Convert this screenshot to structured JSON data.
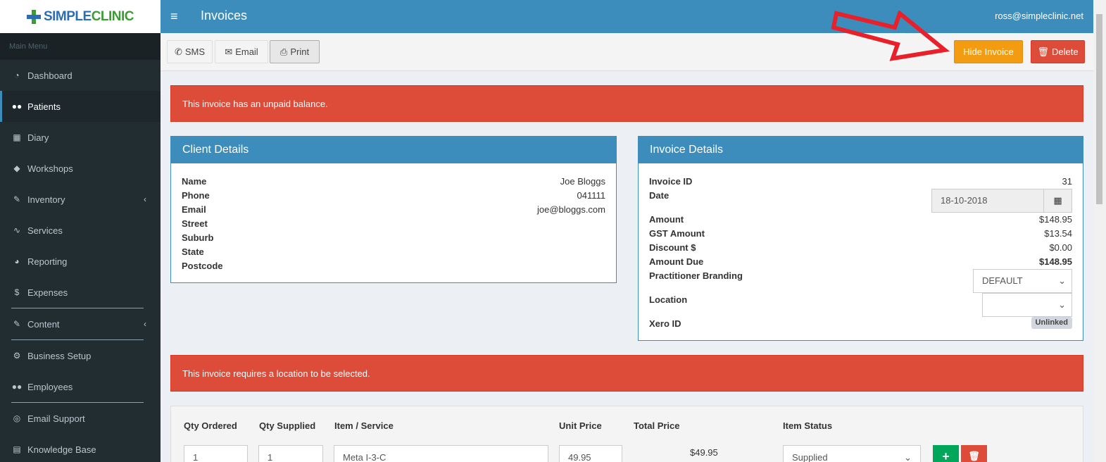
{
  "logo": {
    "part1": "SIMPLE",
    "part2": "CLINIC"
  },
  "sidebar": {
    "header": "Main Menu",
    "items": [
      {
        "label": "Dashboard",
        "icon": "dashboard-icon"
      },
      {
        "label": "Patients",
        "icon": "users-icon",
        "active": true
      },
      {
        "label": "Diary",
        "icon": "calendar-icon"
      },
      {
        "label": "Workshops",
        "icon": "graduation-cap-icon"
      },
      {
        "label": "Inventory",
        "icon": "edit-icon",
        "chevron": true
      },
      {
        "label": "Services",
        "icon": "stethoscope-icon"
      },
      {
        "label": "Reporting",
        "icon": "pie-chart-icon"
      },
      {
        "label": "Expenses",
        "icon": "dollar-icon"
      },
      {
        "label": "Content",
        "icon": "edit-icon",
        "chevron": true
      },
      {
        "label": "Business Setup",
        "icon": "gears-icon"
      },
      {
        "label": "Employees",
        "icon": "users-icon"
      },
      {
        "label": "Email Support",
        "icon": "lifebuoy-icon"
      },
      {
        "label": "Knowledge Base",
        "icon": "book-icon"
      }
    ]
  },
  "header": {
    "title": "Invoices",
    "user": "ross@simpleclinic.net"
  },
  "toolbar": {
    "sms": "SMS",
    "email": "Email",
    "print": "Print",
    "hide": "Hide Invoice",
    "delete": "Delete"
  },
  "alerts": {
    "unpaid": "This invoice has an unpaid balance.",
    "location": "This invoice requires a location to be selected."
  },
  "client": {
    "title": "Client Details",
    "labels": {
      "name": "Name",
      "phone": "Phone",
      "email": "Email",
      "street": "Street",
      "suburb": "Suburb",
      "state": "State",
      "postcode": "Postcode"
    },
    "name": "Joe Bloggs",
    "phone": "041111",
    "email": "joe@bloggs.com"
  },
  "invoice": {
    "title": "Invoice Details",
    "labels": {
      "id": "Invoice ID",
      "date": "Date",
      "amount": "Amount",
      "gst": "GST Amount",
      "discount": "Discount $",
      "due": "Amount Due",
      "branding": "Practitioner Branding",
      "location": "Location",
      "xero": "Xero ID"
    },
    "id": "31",
    "date": "18-10-2018",
    "amount": "$148.95",
    "gst": "$13.54",
    "discount": "$0.00",
    "due": "$148.95",
    "branding": "DEFAULT",
    "location": "",
    "xero": "Unlinked"
  },
  "items": {
    "headers": {
      "qty_ordered": "Qty Ordered",
      "qty_supplied": "Qty Supplied",
      "item": "Item / Service",
      "unit_price": "Unit Price",
      "total_price": "Total Price",
      "status": "Item Status"
    },
    "rows": [
      {
        "qty_ordered": "1",
        "qty_supplied": "1",
        "item": "Meta I-3-C",
        "unit_price": "49.95",
        "total_price": "$49.95",
        "status": "Supplied"
      }
    ]
  }
}
